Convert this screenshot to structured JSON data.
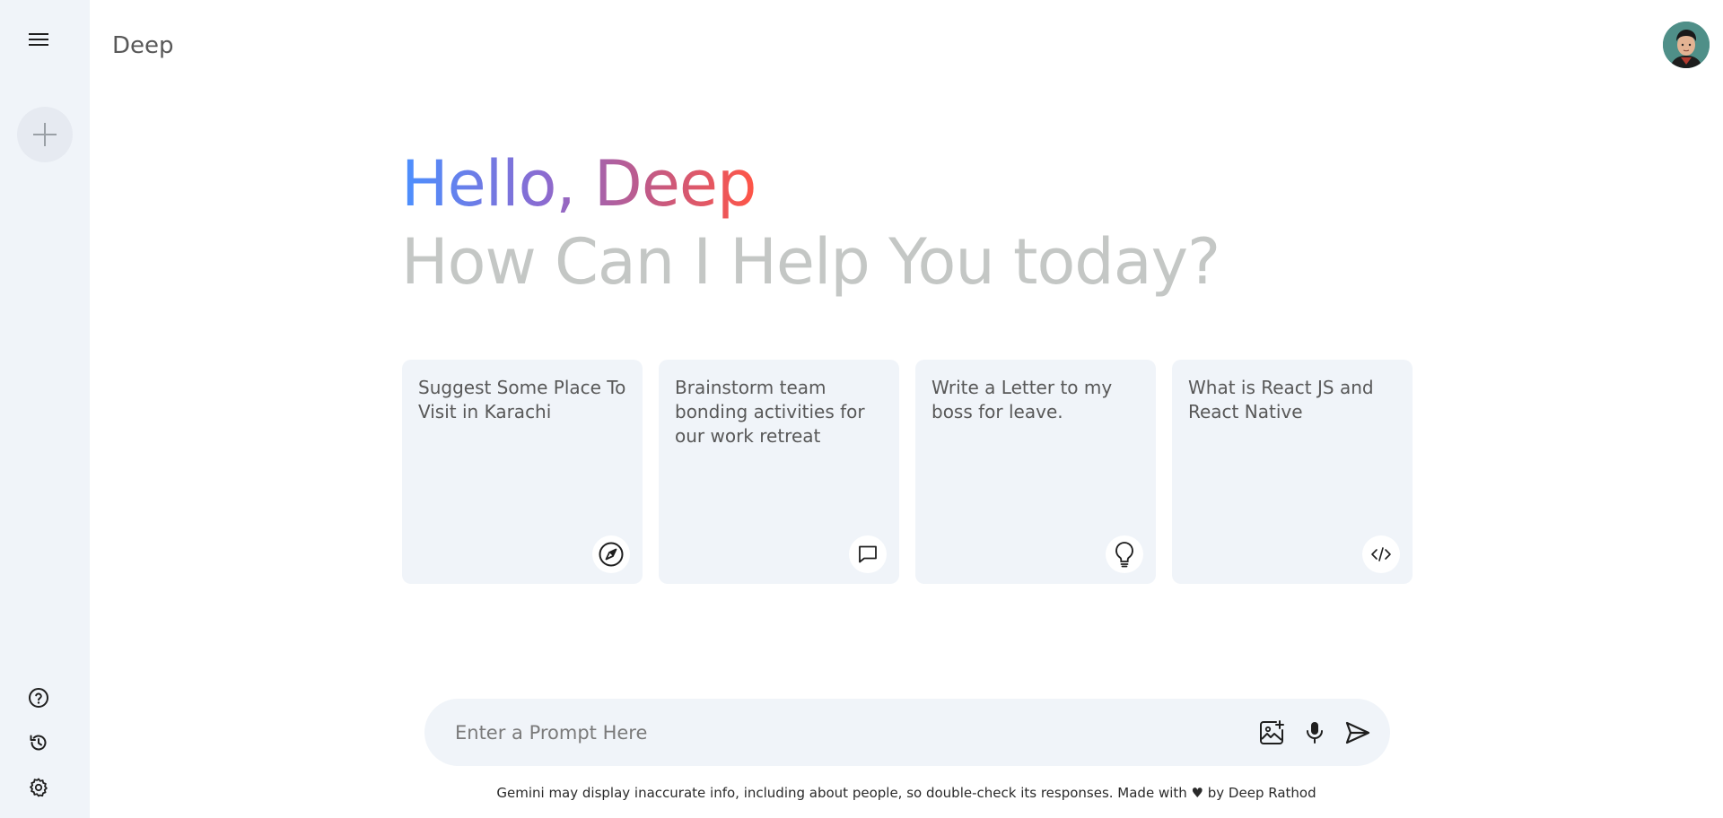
{
  "sidebar": {
    "menu_icon": "menu-icon",
    "new_chat_icon": "plus-icon",
    "bottom": [
      {
        "name": "help",
        "icon": "question-icon"
      },
      {
        "name": "activity",
        "icon": "history-icon"
      },
      {
        "name": "settings",
        "icon": "gear-icon"
      }
    ]
  },
  "nav": {
    "title": "Deep"
  },
  "greeting": {
    "hello": "Hello, Deep",
    "subtitle": "How Can I Help You today?"
  },
  "cards": [
    {
      "text": "Suggest Some Place To Visit in Karachi",
      "icon": "compass-icon"
    },
    {
      "text": "Brainstorm team bonding activities for our work retreat",
      "icon": "message-icon"
    },
    {
      "text": "Write a Letter to my boss for leave.",
      "icon": "bulb-icon"
    },
    {
      "text": "What is React JS and React Native",
      "icon": "code-icon"
    }
  ],
  "prompt": {
    "placeholder": "Enter a Prompt Here",
    "icons": [
      "gallery-icon",
      "mic-icon",
      "send-icon"
    ]
  },
  "footer": {
    "text_before": "Gemini may display inaccurate info, including about people, so double-check its responses. Made with ",
    "heart": "♥",
    "text_after": " by Deep Rathod"
  },
  "colors": {
    "sidebar_bg": "#f0f4f9",
    "card_bg": "#f0f4f9",
    "gradient_start": "#4b90ff",
    "gradient_end": "#ff5546",
    "subtitle": "#c4c7c5"
  }
}
